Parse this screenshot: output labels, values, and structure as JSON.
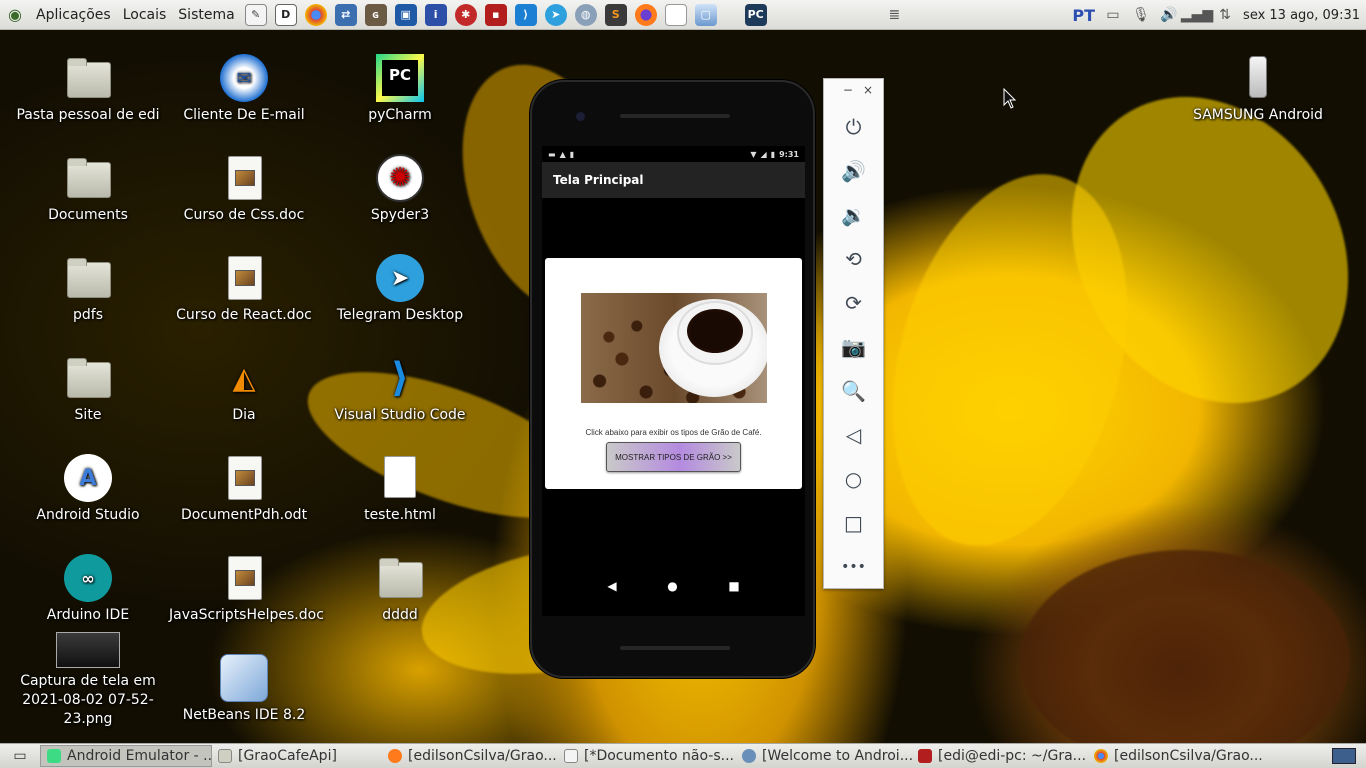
{
  "top_panel": {
    "menus": [
      "Aplicações",
      "Locais",
      "Sistema"
    ],
    "language": "PT",
    "clock": "sex 13 ago, 09:31",
    "launchers": [
      "text-editor-icon",
      "dia-icon",
      "chrome-icon",
      "network-icon",
      "gimp-icon",
      "virtualbox-icon",
      "info-icon",
      "red-app-icon",
      "terminal-icon",
      "vscode-icon",
      "telegram-icon",
      "globe-icon",
      "sublime-icon",
      "firefox-icon",
      "blank-doc-icon",
      "netbeans-icon",
      "pycharm-icon",
      "database-icon"
    ]
  },
  "desktop": {
    "icons": [
      {
        "label": "Pasta pessoal de edi",
        "kind": "home-folder-icon"
      },
      {
        "label": "Documents",
        "kind": "folder-icon"
      },
      {
        "label": "pdfs",
        "kind": "folder-icon"
      },
      {
        "label": "Site",
        "kind": "folder-icon"
      },
      {
        "label": "Android Studio",
        "kind": "android-studio-icon"
      },
      {
        "label": "Arduino IDE",
        "kind": "arduino-icon"
      },
      {
        "label": "Captura de tela em 2021-08-02 07-52-23.png",
        "kind": "screenshot-thumbnail-icon"
      },
      {
        "label": "Cliente De E-mail",
        "kind": "email-client-icon"
      },
      {
        "label": "Curso de Css.doc",
        "kind": "document-icon"
      },
      {
        "label": "Curso de React.doc",
        "kind": "document-icon"
      },
      {
        "label": "Dia",
        "kind": "dia-icon"
      },
      {
        "label": "DocumentPdh.odt",
        "kind": "document-icon"
      },
      {
        "label": "JavaScriptsHelpes.doc",
        "kind": "document-icon"
      },
      {
        "label": "NetBeans IDE 8.2",
        "kind": "netbeans-icon"
      },
      {
        "label": "pyCharm",
        "kind": "pycharm-icon"
      },
      {
        "label": "Spyder3",
        "kind": "spyder-icon"
      },
      {
        "label": "Telegram Desktop",
        "kind": "telegram-icon"
      },
      {
        "label": "Visual Studio Code",
        "kind": "vscode-icon"
      },
      {
        "label": "teste.html",
        "kind": "html-file-icon"
      },
      {
        "label": "dddd",
        "kind": "folder-icon"
      },
      {
        "label": "SAMSUNG Android",
        "kind": "phone-device-icon"
      }
    ]
  },
  "emulator": {
    "status_time": "9:31",
    "app_title": "Tela Principal",
    "hint_text": "Click abaixo para exibir os tipos de Grão de Café.",
    "button_label": "MOSTRAR TIPOS DE GRÃO >>",
    "nav": {
      "back": "◀",
      "home": "●",
      "recents": "■"
    }
  },
  "emulator_toolbar": {
    "minimize": "−",
    "close": "×",
    "buttons": [
      "power-icon",
      "volume-up-icon",
      "volume-down-icon",
      "rotate-left-icon",
      "rotate-right-icon",
      "camera-icon",
      "zoom-icon",
      "back-icon",
      "home-icon",
      "overview-icon",
      "more-icon"
    ],
    "glyphs": [
      "⏻",
      "🔊",
      "🔉",
      "⟲",
      "⟳",
      "📷",
      "🔍",
      "◁",
      "○",
      "□",
      "•••"
    ]
  },
  "taskbar": {
    "tasks": [
      {
        "label": "Android Emulator - ...",
        "active": true
      },
      {
        "label": "[GraoCafeApi]",
        "active": false
      },
      {
        "label": "[edilsonCsilva/Grao...",
        "active": false
      },
      {
        "label": "[*Documento não-s...",
        "active": false
      },
      {
        "label": "[Welcome to Androi...",
        "active": false
      },
      {
        "label": "[edi@edi-pc: ~/Gra...",
        "active": false
      },
      {
        "label": "[edilsonCsilva/Grao...",
        "active": false
      }
    ]
  },
  "colors": {
    "panel_bg": "#e6e6e2",
    "action_bar": "#232323",
    "button_accent": "#b48ae0"
  }
}
